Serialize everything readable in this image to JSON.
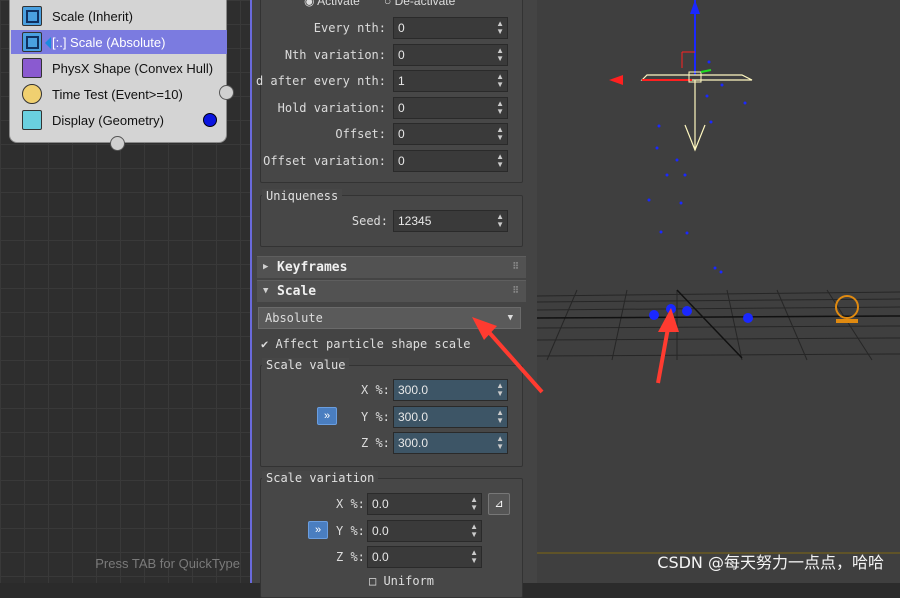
{
  "particle_view": {
    "operators": [
      {
        "label": "Scale (Inherit)",
        "icon": "scale-icon"
      },
      {
        "label": "[:.] Scale (Absolute)",
        "icon": "scale-icon"
      },
      {
        "label": "PhysX Shape (Convex Hull)",
        "icon": "physx-shape-icon"
      },
      {
        "label": "Time Test (Event>=10)",
        "icon": "clock-icon"
      },
      {
        "label": "Display (Geometry)",
        "icon": "display-icon"
      }
    ],
    "hint": "Press TAB for QuickType"
  },
  "panel": {
    "activate": "Activate",
    "deactivate": "De-activate",
    "fields": [
      {
        "label": "Every nth:",
        "value": "0"
      },
      {
        "label": "Nth variation:",
        "value": "0"
      },
      {
        "label": "d after every nth:",
        "value": "1"
      },
      {
        "label": "Hold variation:",
        "value": "0"
      },
      {
        "label": "Offset:",
        "value": "0"
      },
      {
        "label": "Offset variation:",
        "value": "0"
      }
    ],
    "uniqueness": {
      "title": "Uniqueness",
      "seed_label": "Seed:",
      "seed_value": "12345"
    },
    "keyframes_title": "Keyframes",
    "scale_title": "Scale",
    "scale_type": "Absolute",
    "affect_label": "Affect particle shape scale",
    "scale_value": {
      "title": "Scale value",
      "x_label": "X %:",
      "x": "300.0",
      "y_label": "Y %:",
      "y": "300.0",
      "z_label": "Z %:",
      "z": "300.0",
      "link_button": "»"
    },
    "scale_variation": {
      "title": "Scale variation",
      "x_label": "X %:",
      "x": "0.0",
      "y_label": "Y %:",
      "y": "0.0",
      "z_label": "Z %:",
      "z": "0.0",
      "link_button": "»",
      "uniform_label": "Uniform"
    }
  },
  "viewport": {
    "watermark": "CSDN @每天努力一点点，哈哈",
    "colors": {
      "particle": "#1a28ff",
      "arrow": "#ff3b30",
      "gizmo": "#fff8c0"
    }
  }
}
